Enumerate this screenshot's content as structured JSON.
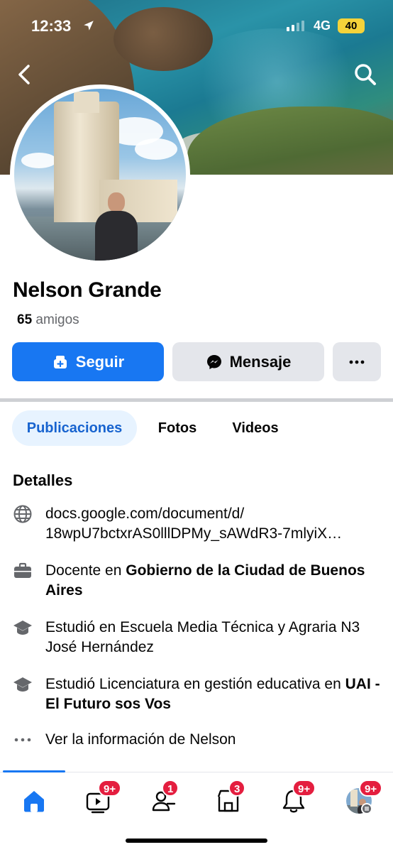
{
  "status_bar": {
    "time": "12:33",
    "network": "4G",
    "battery": "40",
    "location_icon": "location-arrow-icon",
    "signal_icon": "cellular-signal-icon"
  },
  "header": {
    "back_icon": "chevron-left-icon",
    "search_icon": "search-icon"
  },
  "profile": {
    "name": "Nelson Grande",
    "friends_count": "65",
    "friends_label": "amigos"
  },
  "actions": {
    "follow_label": "Seguir",
    "follow_icon": "follow-user-icon",
    "message_label": "Mensaje",
    "message_icon": "messenger-icon",
    "more_icon": "more-horizontal-icon"
  },
  "tabs": [
    {
      "label": "Publicaciones",
      "active": true
    },
    {
      "label": "Fotos",
      "active": false
    },
    {
      "label": "Videos",
      "active": false
    }
  ],
  "details": {
    "title": "Detalles",
    "link": {
      "line1": "docs.google.com/document/d/",
      "line2": "18wpU7bctxrAS0lllDPMy_sAWdR3-7mlyiX…",
      "icon": "globe-icon"
    },
    "work": {
      "prefix": "Docente en ",
      "employer": "Gobierno de la Ciudad de Buenos Aires",
      "icon": "briefcase-icon"
    },
    "education1": {
      "text": "Estudió en Escuela Media Técnica y Agraria N3 José Hernández",
      "icon": "graduation-cap-icon"
    },
    "education2": {
      "prefix": "Estudió Licenciatura en gestión educativa en ",
      "school": "UAI - El Futuro sos Vos",
      "icon": "graduation-cap-icon"
    },
    "more": {
      "label": "Ver la información de Nelson",
      "icon": "more-dots-icon"
    }
  },
  "bottom_nav": {
    "home": {
      "icon": "home-icon"
    },
    "video": {
      "icon": "video-icon",
      "badge": "9+"
    },
    "friends": {
      "icon": "friends-icon",
      "badge": "1"
    },
    "marketplace": {
      "icon": "marketplace-icon",
      "badge": "3"
    },
    "notifications": {
      "icon": "bell-icon",
      "badge": "9+"
    },
    "menu": {
      "icon": "profile-menu-icon",
      "badge": "9+"
    }
  },
  "colors": {
    "accent": "#1877f2",
    "badge": "#e41e3f",
    "tab_active_bg": "#e7f3ff",
    "secondary_text": "#65676b"
  }
}
